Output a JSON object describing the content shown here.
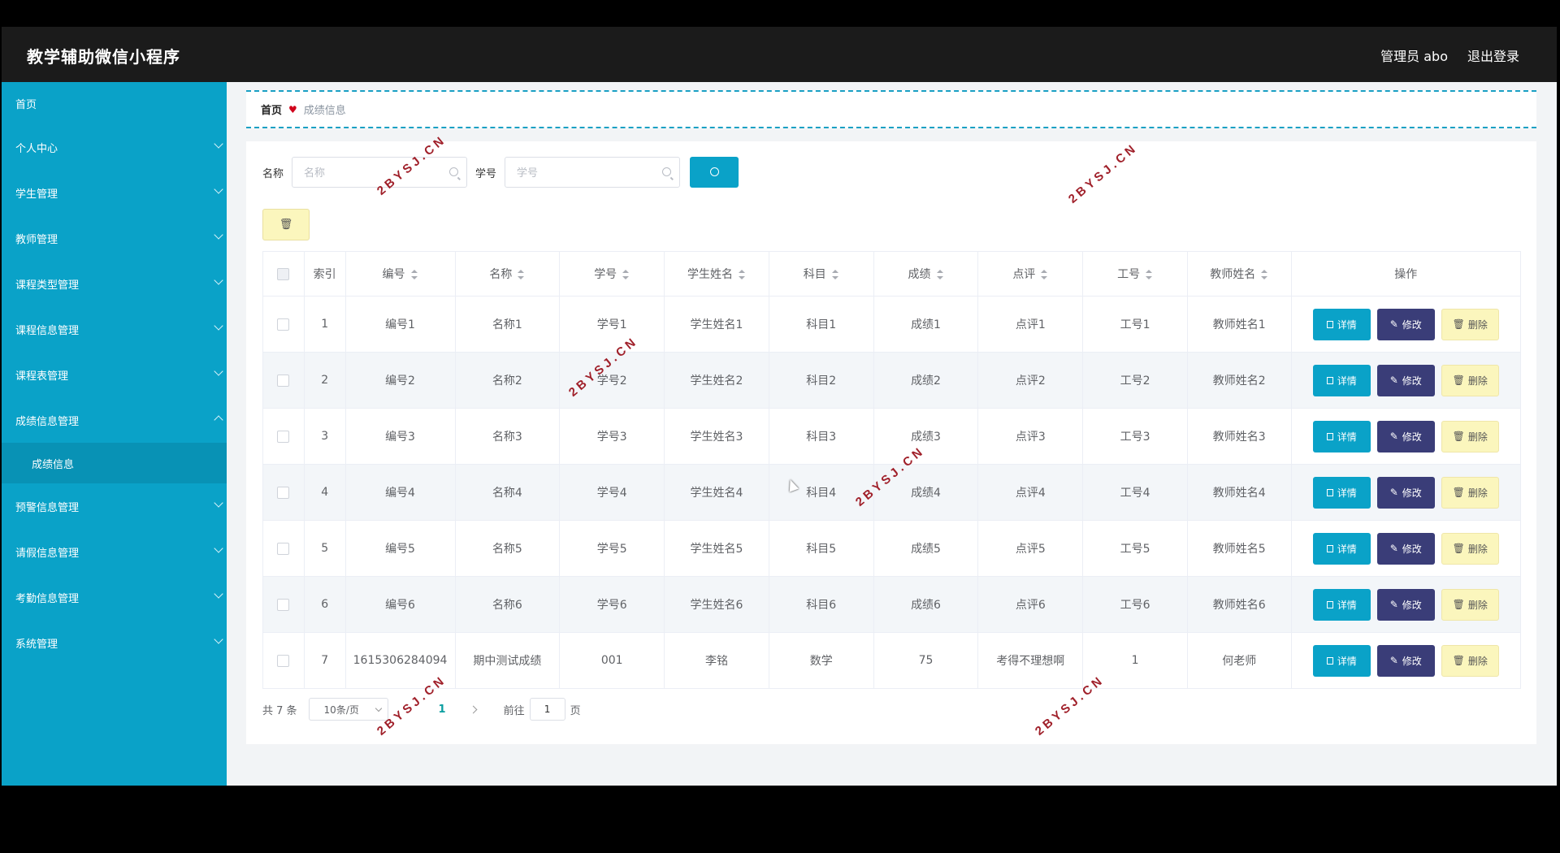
{
  "header": {
    "app_title": "教学辅助微信小程序",
    "admin_label": "管理员 abo",
    "logout_label": "退出登录"
  },
  "sidebar": {
    "items": [
      {
        "label": "首页",
        "has_children": false
      },
      {
        "label": "个人中心",
        "has_children": true
      },
      {
        "label": "学生管理",
        "has_children": true
      },
      {
        "label": "教师管理",
        "has_children": true
      },
      {
        "label": "课程类型管理",
        "has_children": true
      },
      {
        "label": "课程信息管理",
        "has_children": true
      },
      {
        "label": "课程表管理",
        "has_children": true
      },
      {
        "label": "成绩信息管理",
        "has_children": true,
        "expanded": true
      },
      {
        "label": "预警信息管理",
        "has_children": true
      },
      {
        "label": "请假信息管理",
        "has_children": true
      },
      {
        "label": "考勤信息管理",
        "has_children": true
      },
      {
        "label": "系统管理",
        "has_children": true
      }
    ],
    "active_sub_item": "成绩信息"
  },
  "breadcrumb": {
    "home": "首页",
    "current": "成绩信息"
  },
  "search": {
    "name_label": "名称",
    "name_placeholder": "名称",
    "student_no_label": "学号",
    "student_no_placeholder": "学号"
  },
  "table": {
    "headers": [
      "索引",
      "编号",
      "名称",
      "学号",
      "学生姓名",
      "科目",
      "成绩",
      "点评",
      "工号",
      "教师姓名",
      "操作"
    ],
    "rows": [
      [
        "1",
        "编号1",
        "名称1",
        "学号1",
        "学生姓名1",
        "科目1",
        "成绩1",
        "点评1",
        "工号1",
        "教师姓名1"
      ],
      [
        "2",
        "编号2",
        "名称2",
        "学号2",
        "学生姓名2",
        "科目2",
        "成绩2",
        "点评2",
        "工号2",
        "教师姓名2"
      ],
      [
        "3",
        "编号3",
        "名称3",
        "学号3",
        "学生姓名3",
        "科目3",
        "成绩3",
        "点评3",
        "工号3",
        "教师姓名3"
      ],
      [
        "4",
        "编号4",
        "名称4",
        "学号4",
        "学生姓名4",
        "科目4",
        "成绩4",
        "点评4",
        "工号4",
        "教师姓名4"
      ],
      [
        "5",
        "编号5",
        "名称5",
        "学号5",
        "学生姓名5",
        "科目5",
        "成绩5",
        "点评5",
        "工号5",
        "教师姓名5"
      ],
      [
        "6",
        "编号6",
        "名称6",
        "学号6",
        "学生姓名6",
        "科目6",
        "成绩6",
        "点评6",
        "工号6",
        "教师姓名6"
      ],
      [
        "7",
        "1615306284094",
        "期中测试成绩",
        "001",
        "李铭",
        "数学",
        "75",
        "考得不理想啊",
        "1",
        "何老师"
      ]
    ],
    "actions": {
      "detail": "详情",
      "edit": "修改",
      "delete": "删除"
    }
  },
  "pagination": {
    "total_text": "共 7 条",
    "page_size": "10条/页",
    "current_page": "1",
    "goto_label": "前往",
    "goto_value": "1",
    "page_suffix": "页"
  },
  "watermark": "2BYSJ.CN",
  "colors": {
    "sidebar": "#0aa2c8",
    "topbar": "#1b1b1b",
    "detail_button": "#0aa2c8",
    "edit_button": "#3a3d78",
    "delete_button": "#fbf6bd"
  }
}
